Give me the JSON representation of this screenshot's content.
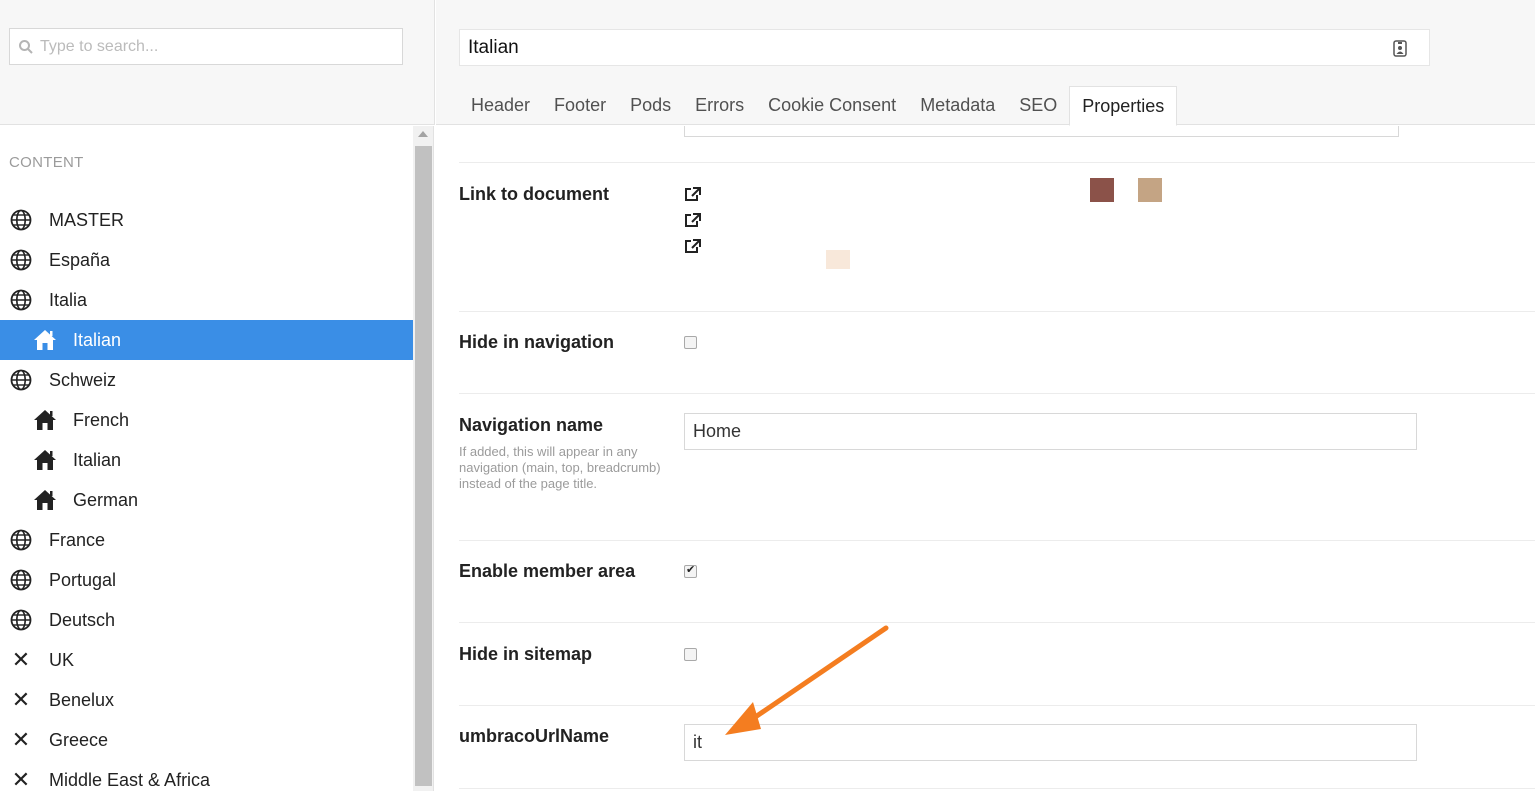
{
  "search": {
    "placeholder": "Type to search..."
  },
  "tree": {
    "section_label": "CONTENT",
    "items": [
      {
        "label": "MASTER",
        "icon": "globe-icon"
      },
      {
        "label": "España",
        "icon": "globe-icon"
      },
      {
        "label": "Italia",
        "icon": "globe-icon"
      },
      {
        "label": "Italian",
        "icon": "home-icon",
        "selected": true
      },
      {
        "label": "Schweiz",
        "icon": "globe-icon"
      },
      {
        "label": "French",
        "icon": "home-icon"
      },
      {
        "label": "Italian",
        "icon": "home-icon"
      },
      {
        "label": "German",
        "icon": "home-icon"
      },
      {
        "label": "France",
        "icon": "globe-icon"
      },
      {
        "label": "Portugal",
        "icon": "globe-icon"
      },
      {
        "label": "Deutsch",
        "icon": "globe-icon"
      },
      {
        "label": "UK",
        "icon": "close-icon"
      },
      {
        "label": "Benelux",
        "icon": "close-icon"
      },
      {
        "label": "Greece",
        "icon": "close-icon"
      },
      {
        "label": "Middle East & Africa",
        "icon": "close-icon"
      }
    ]
  },
  "header": {
    "name_value": "Italian",
    "tabs": [
      "Header",
      "Footer",
      "Pods",
      "Errors",
      "Cookie Consent",
      "Metadata",
      "SEO",
      "Properties"
    ],
    "active_tab": "Properties"
  },
  "properties": {
    "link_to_document": {
      "label": "Link to document"
    },
    "hide_in_navigation": {
      "label": "Hide in navigation",
      "checked": false
    },
    "navigation_name": {
      "label": "Navigation name",
      "description": "If added, this will appear in any navigation (main, top, breadcrumb) instead of the page title.",
      "value": "Home"
    },
    "enable_member_area": {
      "label": "Enable member area",
      "checked": true
    },
    "hide_in_sitemap": {
      "label": "Hide in sitemap",
      "checked": false
    },
    "umbraco_url_name": {
      "label": "umbracoUrlName",
      "value": "it"
    }
  },
  "colors": {
    "selected_bg": "#3a8ee6",
    "arrow": "#f47d20",
    "swatch_brown": "#8b5249",
    "swatch_tan": "#c4a484",
    "swatch_cream": "#f8e8da"
  }
}
